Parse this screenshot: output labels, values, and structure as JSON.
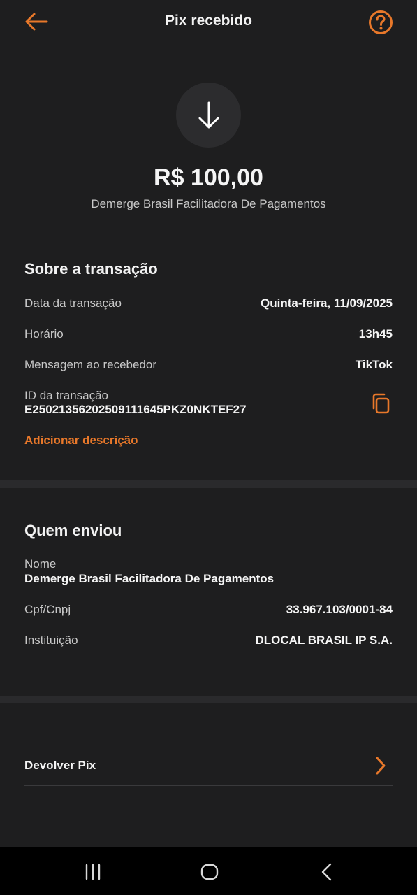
{
  "header": {
    "title": "Pix recebido",
    "back_icon": "arrow-left-icon",
    "help_icon": "question-circle-icon"
  },
  "hero": {
    "icon": "arrow-down-icon",
    "amount": "R$ 100,00",
    "counterparty": "Demerge Brasil Facilitadora De Pagamentos"
  },
  "transaction": {
    "section_title": "Sobre a transação",
    "date_label": "Data da transação",
    "date_value": "Quinta-feira, 11/09/2025",
    "time_label": "Horário",
    "time_value": "13h45",
    "message_label": "Mensagem ao recebedor",
    "message_value": "TikTok",
    "id_label": "ID da transação",
    "id_value": "E25021356202509111645PKZ0NKTEF27",
    "copy_icon": "copy-icon",
    "add_description": "Adicionar descrição"
  },
  "sender": {
    "section_title": "Quem enviou",
    "name_label": "Nome",
    "name_value": "Demerge Brasil Facilitadora De Pagamentos",
    "doc_label": "Cpf/Cnpj",
    "doc_value": "33.967.103/0001-84",
    "institution_label": "Instituição",
    "institution_value": "DLOCAL BRASIL IP S.A."
  },
  "actions": {
    "return_pix": "Devolver Pix",
    "chevron_icon": "chevron-right-icon"
  },
  "navbar": {
    "recents_icon": "recent-apps-icon",
    "home_icon": "home-icon",
    "back_icon": "back-chevron-icon"
  },
  "colors": {
    "background": "#1e1e1f",
    "accent": "#e8782a",
    "text_primary": "#f5f5f5",
    "text_secondary": "#c8c8c8"
  }
}
